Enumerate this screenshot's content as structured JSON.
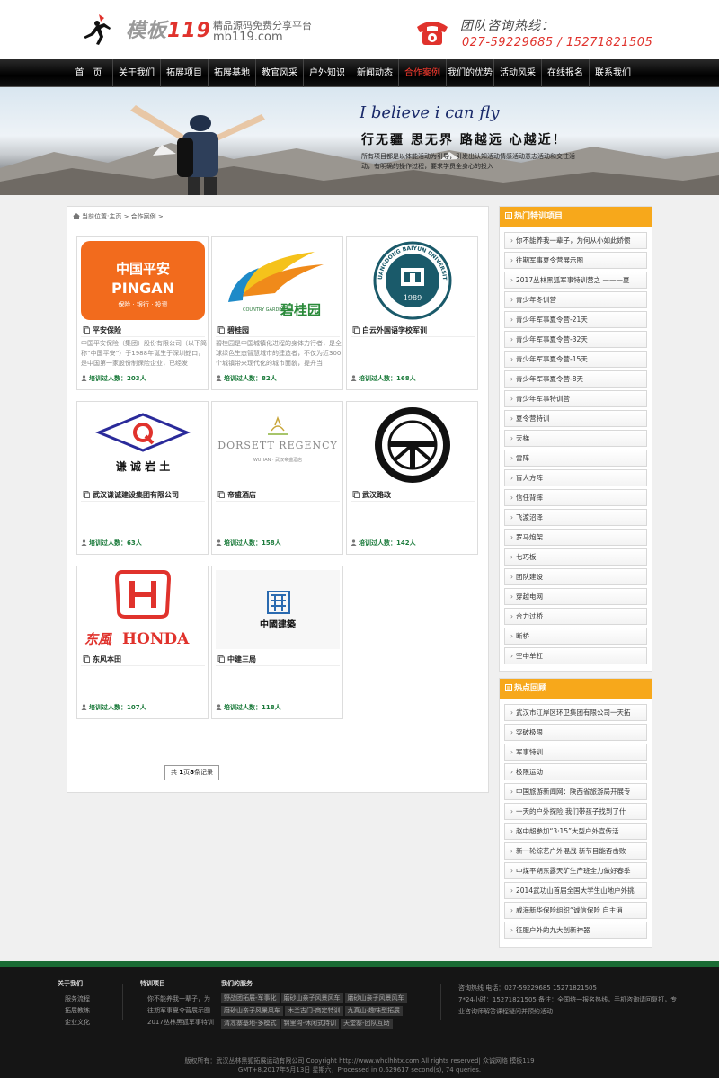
{
  "header": {
    "logo_name": "模板",
    "logo_num": "119",
    "slogan": "精品源码免费分享平台",
    "domain": "mb119.com",
    "hotline_title": "团队咨询热线：",
    "hotline_numbers": "027-59229685 / 15271821505"
  },
  "nav": {
    "items": [
      "首　页",
      "关于我们",
      "拓展项目",
      "拓展基地",
      "教官风采",
      "户外知识",
      "新闻动态",
      "合作案例",
      "我们的优势",
      "活动风采",
      "在线报名",
      "联系我们"
    ],
    "active_index": 7
  },
  "banner": {
    "script": "I believe i can fly",
    "headline": "行无疆 思无界 路越远 心越近！",
    "desc": "所有项目都是以体能活动为引导，引发出认知活动情感活动意志活动和交往活动，有明确的操作过程，要求学员全身心的投入"
  },
  "breadcrumb": {
    "text": "当前位置:主页 > 合作案例 >"
  },
  "cases": [
    {
      "title": "平安保险",
      "desc": "中国平安保险（集团）股份有限公司（以下简称“中国平安”）于1988年诞生于深圳蛇口，是中国第一家股份制保险企业，已经发",
      "count": "培训过人数：203人"
    },
    {
      "title": "碧桂园",
      "desc": "碧桂园是中国城镇化进程的身体力行者，是全球绿色生态智慧城市的建造者，不仅为近300个城镇带来现代化的城市面貌，提升当",
      "count": "培训过人数：82人"
    },
    {
      "title": "白云外国语学校军训",
      "desc": "",
      "count": "培训过人数：168人"
    },
    {
      "title": "武汉谦诚建设集团有限公司",
      "desc": "",
      "count": "培训过人数：63人"
    },
    {
      "title": "帝盛酒店",
      "desc": "",
      "count": "培训过人数：158人"
    },
    {
      "title": "武汉路政",
      "desc": "",
      "count": "培训过人数：142人"
    },
    {
      "title": "东风本田",
      "desc": "",
      "count": "培训过人数：107人"
    },
    {
      "title": "中建三局",
      "desc": "",
      "count": "培训过人数：118人"
    }
  ],
  "logos": {
    "pingan_cn": "中国平安",
    "pingan_en": "PINGAN",
    "pingan_sub": "保险 · 银行 · 投资",
    "country_garden_en": "COUNTRY GARDEN",
    "country_garden_cn": "碧桂园",
    "baiyun_ring": "GUANGDONG BAIYUN UNIVERSITY",
    "baiyun_year": "1989",
    "qiancheng_cn": "谦 诚 岩 土",
    "dorsett_name": "DORSETT REGENCY",
    "dorsett_sub": "WUHAN · 武汉帝盛酒店",
    "honda_cn": "东風",
    "honda_en": "HONDA",
    "cscec_cn": "中國建築"
  },
  "pager": {
    "prefix": "共",
    "pages": "1",
    "mid": "页",
    "records": "8",
    "suffix": "条记录"
  },
  "sidebar_hot_projects": {
    "title": "热门特训项目",
    "items": [
      "你不能养我一辈子，为何从小如此娇惯",
      "往期军事夏令营展示图",
      "2017丛林黑狐军事特训营之 ———夏",
      "青少年冬训营",
      "青少年军事夏令营-21天",
      "青少年军事夏令营-32天",
      "青少年军事夏令营-15天",
      "青少年军事夏令营-8天",
      "青少年军事特训营",
      "夏令营特训",
      "天梯",
      "雷阵",
      "盲人方阵",
      "信任背摔",
      "飞渡沼泽",
      "罗马炮架",
      "七巧板",
      "团队建设",
      "穿越电网",
      "合力过桥",
      "断桥",
      "空中单杠"
    ]
  },
  "sidebar_hot_review": {
    "title": "热点回顾",
    "items": [
      "武汉市江岸区环卫集团有限公司一天拓",
      "突破极限",
      "军事特训",
      "极限运动",
      "中国旅游新闻网：陕西省旅游局开展专",
      "一天的户外探险 我们带孩子找到了什",
      "赵中超参加“3·15”大型户外宣传活",
      "新一轮综艺户外混战 新节目能否击败",
      "中煤平朔东露天矿生产班全力做好春季",
      "2014武功山首届全国大学生山地户外挑",
      "威海新华保险组织“诚信保险 自主消",
      "征服户外的九大创新神器"
    ]
  },
  "footer": {
    "about_title": "关于我们",
    "about_items": [
      "服务流程",
      "拓展教练",
      "企业文化"
    ],
    "train_title": "特训项目",
    "train_items": [
      "你不能养我一辈子，为",
      "往期军事夏令营展示图",
      "2017丛林黑狐军事特训"
    ],
    "service_title": "我们的服务",
    "service_tags": [
      "野战团拓展-军事化",
      "磨砂山亲子风景风车",
      "磨砂山亲子风景风车",
      "磨砂山亲子风景风车",
      "木兰古门-商定特训",
      "九真山-趣味型拓展",
      "清凉寨基地-多模式",
      "锦里沟-休闲式特训",
      "天堂寨-团队互助"
    ],
    "contact_lines": [
      "咨询热线 电话：027-59229685 15271821505",
      "7*24小时：15271821505 备注：全国统一报名热线，手机咨询请回复打，专",
      "业咨询师解答课程疑问并预约活动"
    ],
    "copyright": "版权所有：武汉丛林黑狐拓展运动有限公司 Copyright http://www.whclhhtx.com All rights reserved|  众诚网络   模板119",
    "gmt": "GMT+8,2017年5月13日 星期六，Processed in 0.629617 second(s), 74 queries."
  },
  "colors": {
    "accent_red": "#e0322c",
    "sidebar_orange": "#f7a81b",
    "footer_green": "#1a6b34",
    "count_green": "#1a7a3a"
  }
}
